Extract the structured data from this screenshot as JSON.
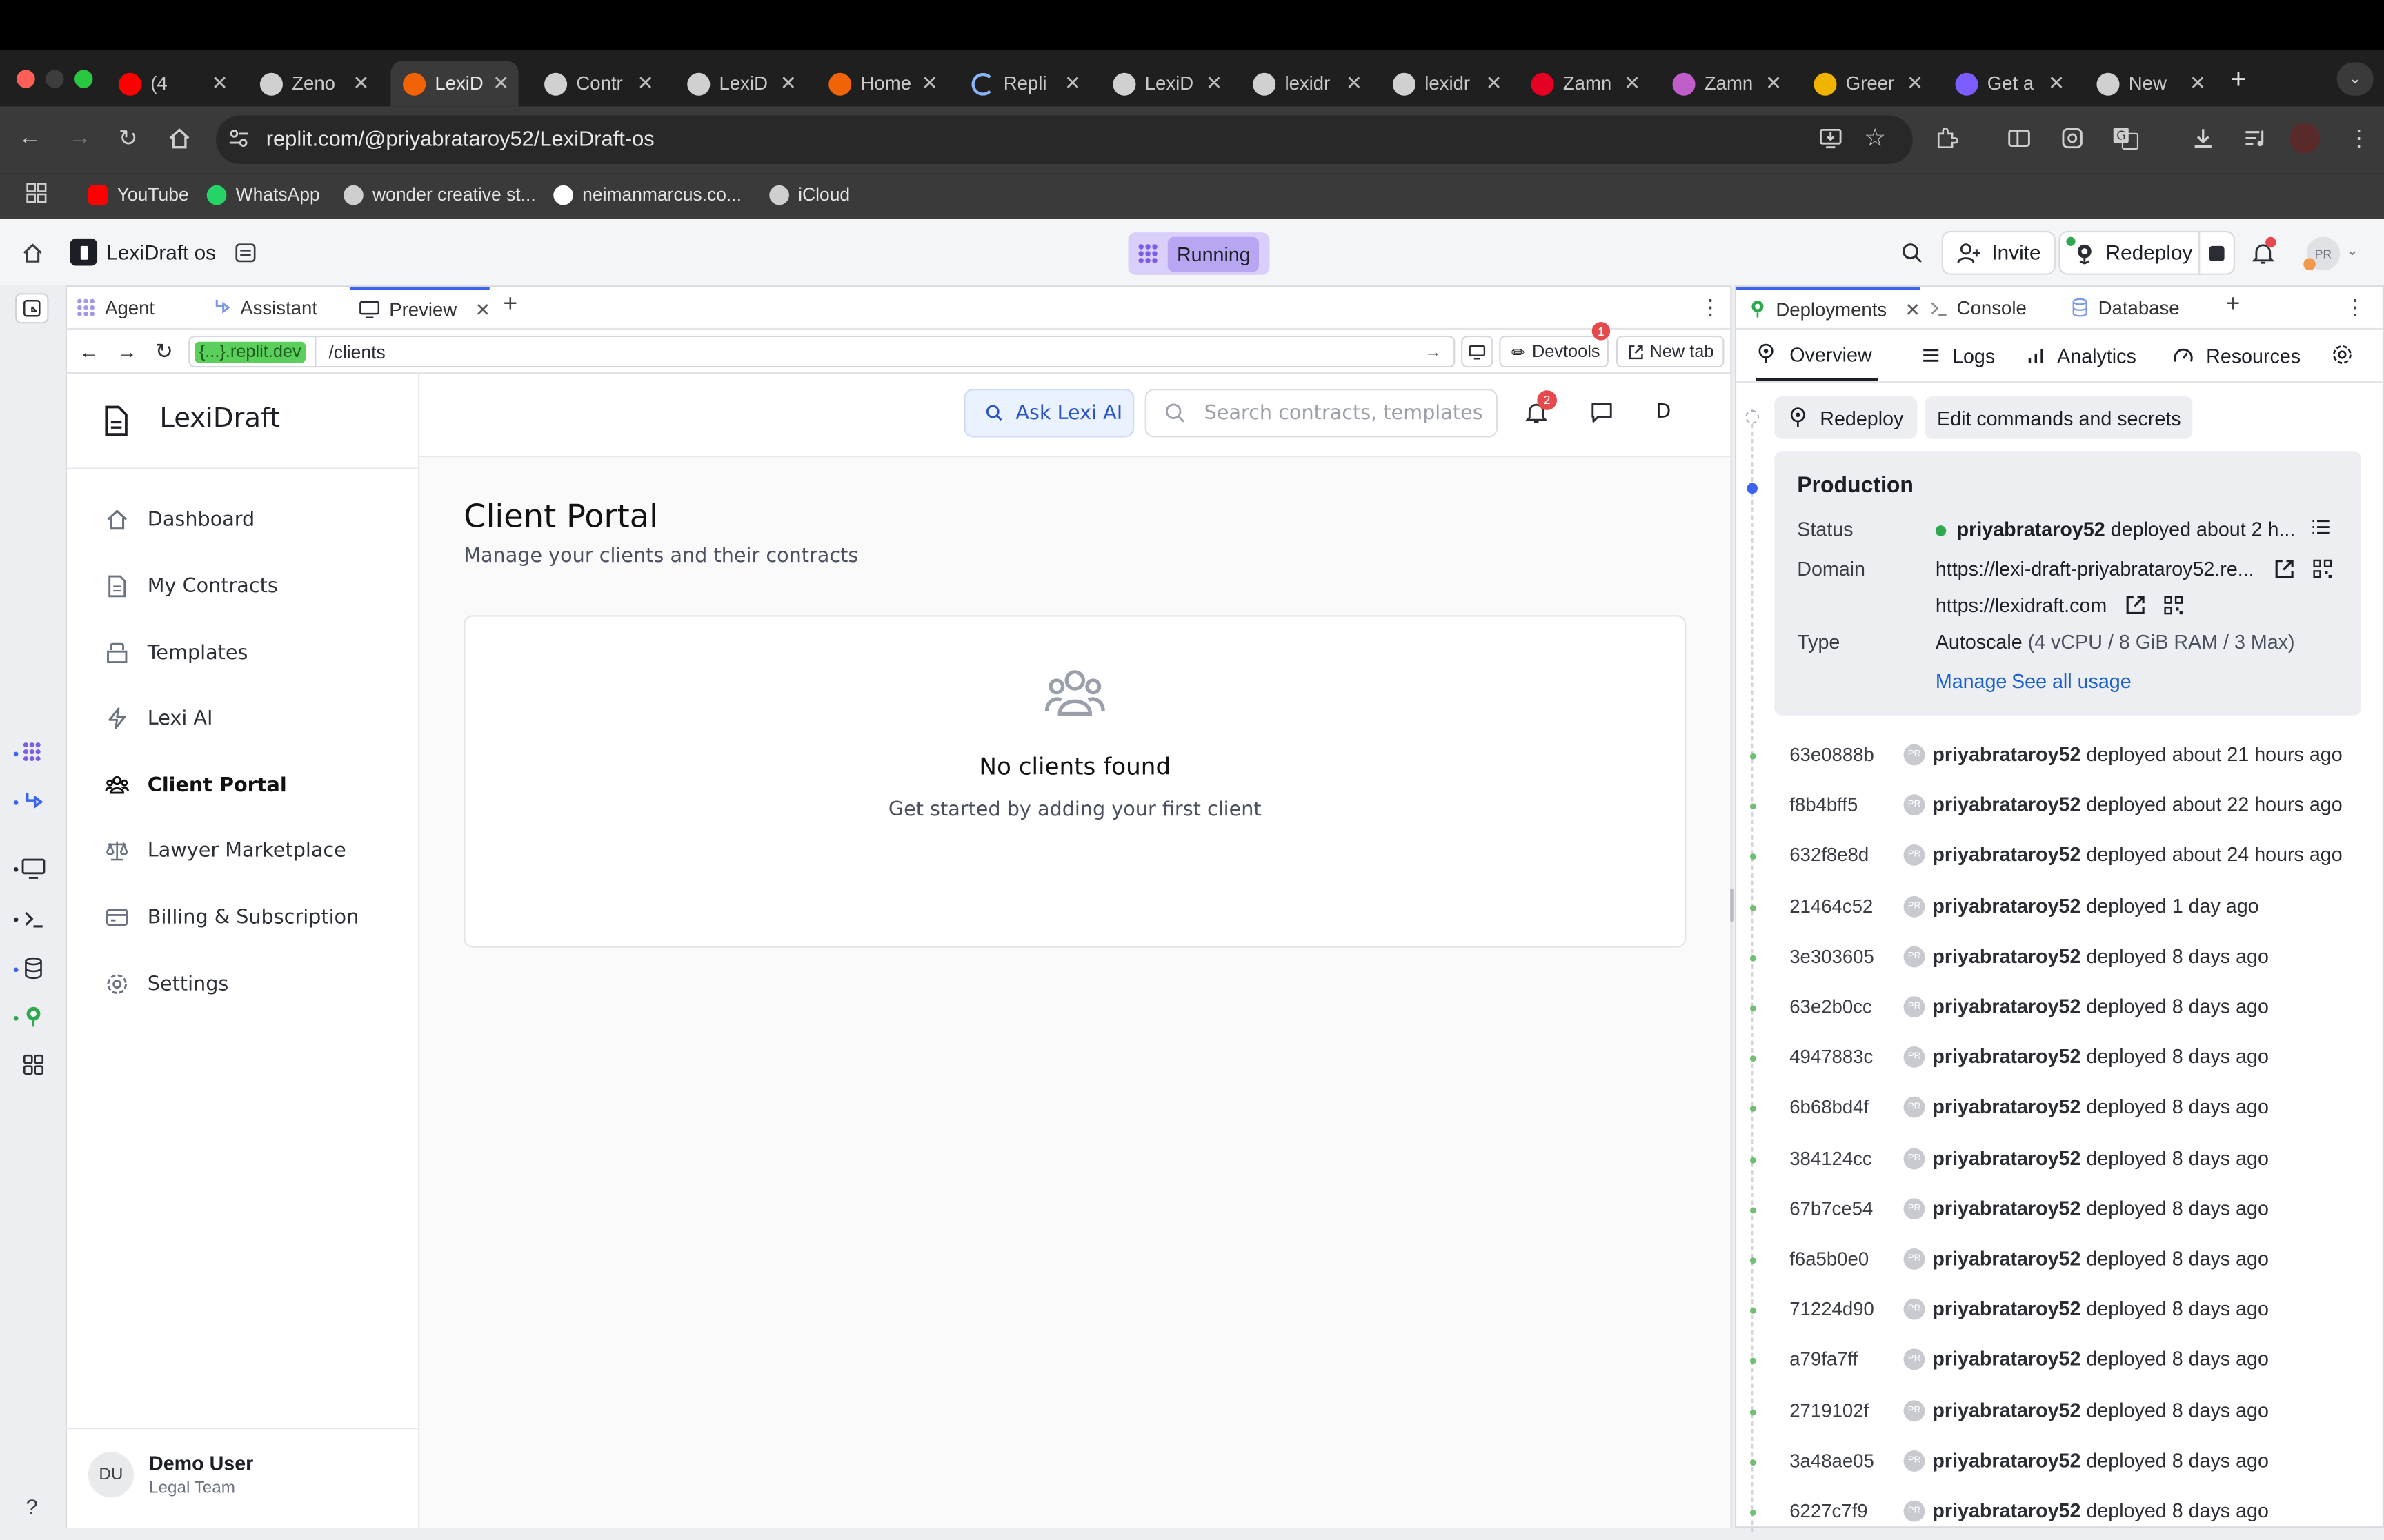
{
  "browser": {
    "tabs": [
      {
        "label": "(4",
        "icon": "youtube-icon",
        "color": "#ff0000"
      },
      {
        "label": "Zeno",
        "icon": "openai-icon",
        "color": "#d0d0d0"
      },
      {
        "label": "LexiD",
        "icon": "replit-icon",
        "color": "#f26207",
        "active": true
      },
      {
        "label": "Contr",
        "icon": "globe-icon",
        "color": "#d0d0d0"
      },
      {
        "label": "LexiD",
        "icon": "globe-icon",
        "color": "#d0d0d0"
      },
      {
        "label": "Home",
        "icon": "replit-icon",
        "color": "#f26207"
      },
      {
        "label": "Repli",
        "icon": "loading-icon",
        "color": "#8ab4f8"
      },
      {
        "label": "LexiD",
        "icon": "globe-icon",
        "color": "#d0d0d0"
      },
      {
        "label": "lexidr",
        "icon": "globe-icon",
        "color": "#d0d0d0"
      },
      {
        "label": "lexidr",
        "icon": "globe-icon",
        "color": "#d0d0d0"
      },
      {
        "label": "Zamn",
        "icon": "pinterest-icon",
        "color": "#e60023"
      },
      {
        "label": "Zamn",
        "icon": "app-icon",
        "color": "#c05ec9"
      },
      {
        "label": "Greer",
        "icon": "app-icon",
        "color": "#f0b400"
      },
      {
        "label": "Get a",
        "icon": "app-icon",
        "color": "#7b5cff"
      },
      {
        "label": "New",
        "icon": "chrome-icon",
        "color": "#d0d0d0"
      }
    ],
    "url": "replit.com/@priyabrataroy52/LexiDraft-os",
    "bookmarks": [
      {
        "label": "YouTube",
        "icon": "youtube-icon",
        "color": "#ff0000"
      },
      {
        "label": "WhatsApp",
        "icon": "whatsapp-icon",
        "color": "#25d366"
      },
      {
        "label": "wonder creative st...",
        "icon": "globe-icon",
        "color": "#cfcfcf"
      },
      {
        "label": "neimanmarcus.co...",
        "icon": "nm-icon",
        "color": "#ffffff"
      },
      {
        "label": "iCloud",
        "icon": "apple-icon",
        "color": "#cfcfcf"
      }
    ]
  },
  "replit": {
    "project": "LexiDraft os",
    "status": "Running",
    "invite": "Invite",
    "redeploy": "Redeploy",
    "avatar": "PR",
    "notif_badge": true,
    "left_tabs": [
      "Agent",
      "Assistant",
      "Preview"
    ],
    "preview_domain": "{...}.replit.dev",
    "preview_path": "/clients",
    "devtools": "Devtools",
    "devtools_badge": "1",
    "newtab": "New tab"
  },
  "lexidraft": {
    "brand": "LexiDraft",
    "ask": "Ask Lexi AI",
    "search_placeholder": "Search contracts, templates",
    "notif_count": "2",
    "user_initial": "D",
    "nav": [
      "Dashboard",
      "My Contracts",
      "Templates",
      "Lexi AI",
      "Client Portal",
      "Lawyer Marketplace",
      "Billing & Subscription",
      "Settings"
    ],
    "active_nav": "Client Portal",
    "page_title": "Client Portal",
    "page_subtitle": "Manage your clients and their contracts",
    "empty_title": "No clients found",
    "empty_sub": "Get started by adding your first client",
    "user_initials": "DU",
    "user_name": "Demo User",
    "user_role": "Legal Team"
  },
  "deployments": {
    "tabs": [
      "Deployments",
      "Console",
      "Database"
    ],
    "subtabs": [
      "Overview",
      "Logs",
      "Analytics",
      "Resources"
    ],
    "redeploy": "Redeploy",
    "edit": "Edit commands and secrets",
    "production": {
      "title": "Production",
      "status_label": "Status",
      "status_user": "priyabrataroy52",
      "status_text": "deployed about 2 h...",
      "domain_label": "Domain",
      "domain1": "https://lexi-draft-priyabrataroy52.re...",
      "domain2": "https://lexidraft.com",
      "type_label": "Type",
      "type": "Autoscale",
      "type_detail": "(4 vCPU / 8 GiB RAM / 3 Max)",
      "manage": "Manage",
      "usage": "See all usage"
    },
    "history": [
      {
        "hash": "63e0888b",
        "user": "priyabrataroy52",
        "text": "deployed about 21 hours ago"
      },
      {
        "hash": "f8b4bff5",
        "user": "priyabrataroy52",
        "text": "deployed about 22 hours ago"
      },
      {
        "hash": "632f8e8d",
        "user": "priyabrataroy52",
        "text": "deployed about 24 hours ago"
      },
      {
        "hash": "21464c52",
        "user": "priyabrataroy52",
        "text": "deployed 1 day ago"
      },
      {
        "hash": "3e303605",
        "user": "priyabrataroy52",
        "text": "deployed 8 days ago"
      },
      {
        "hash": "63e2b0cc",
        "user": "priyabrataroy52",
        "text": "deployed 8 days ago"
      },
      {
        "hash": "4947883c",
        "user": "priyabrataroy52",
        "text": "deployed 8 days ago"
      },
      {
        "hash": "6b68bd4f",
        "user": "priyabrataroy52",
        "text": "deployed 8 days ago"
      },
      {
        "hash": "384124cc",
        "user": "priyabrataroy52",
        "text": "deployed 8 days ago"
      },
      {
        "hash": "67b7ce54",
        "user": "priyabrataroy52",
        "text": "deployed 8 days ago"
      },
      {
        "hash": "f6a5b0e0",
        "user": "priyabrataroy52",
        "text": "deployed 8 days ago"
      },
      {
        "hash": "71224d90",
        "user": "priyabrataroy52",
        "text": "deployed 8 days ago"
      },
      {
        "hash": "a79fa7ff",
        "user": "priyabrataroy52",
        "text": "deployed 8 days ago"
      },
      {
        "hash": "2719102f",
        "user": "priyabrataroy52",
        "text": "deployed 8 days ago"
      },
      {
        "hash": "3a48ae05",
        "user": "priyabrataroy52",
        "text": "deployed 8 days ago"
      },
      {
        "hash": "6227c7f9",
        "user": "priyabrataroy52",
        "text": "deployed 8 days ago"
      }
    ]
  },
  "colors": {
    "accent": "#3b63f0",
    "running": "#b9a6f3",
    "ok": "#2fa84f",
    "link": "#1a5fd0"
  }
}
